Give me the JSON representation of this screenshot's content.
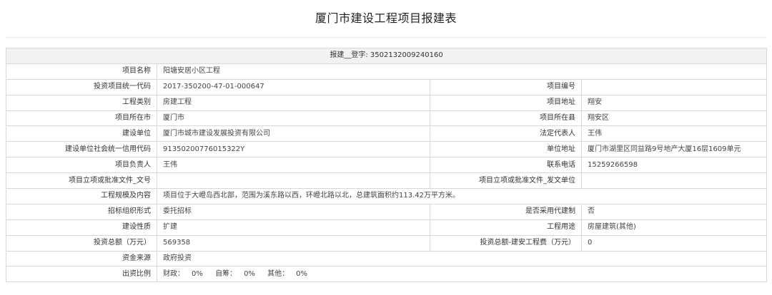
{
  "page_title": "厦门市建设工程项目报建表",
  "header": {
    "prefix": "报建",
    "blank": "__",
    "reg_label": "登字:",
    "reg_number": "3502132009240160"
  },
  "fields": {
    "project_name": {
      "label": "项目名称",
      "value": "阳塘安居小区工程"
    },
    "investment_code": {
      "label": "投资项目统一代码",
      "value": "2017-350200-47-01-000647"
    },
    "project_number": {
      "label": "项目编号",
      "value": ""
    },
    "project_category": {
      "label": "工程类别",
      "value": "房建工程"
    },
    "project_address": {
      "label": "项目地址",
      "value": "翔安"
    },
    "project_city": {
      "label": "项目所在市",
      "value": "厦门市"
    },
    "project_county": {
      "label": "项目所在县",
      "value": "翔安区"
    },
    "builder_unit": {
      "label": "建设单位",
      "value": "厦门市城市建设发展投资有限公司"
    },
    "legal_rep": {
      "label": "法定代表人",
      "value": "王伟"
    },
    "credit_code": {
      "label": "建设单位社会统一信用代码",
      "value": "91350200776015322Y"
    },
    "unit_address": {
      "label": "单位地址",
      "value": "厦门市湖里区同益路9号地产大厦16层1609单元"
    },
    "project_leader": {
      "label": "项目负责人",
      "value": "王伟"
    },
    "contact_phone": {
      "label": "联系电话",
      "value": "15259266598"
    },
    "approval_doc_no": {
      "label": "项目立项或批准文件_文号",
      "value": ""
    },
    "approval_issuer": {
      "label": "项目立项或批准文件_发文单位",
      "value": ""
    },
    "scale_content": {
      "label": "工程规模及内容",
      "value": "项目位于大嶝岛西北部，范围为溪东路以西，环嶝北路以北，总建筑面积约113.42万平方米。"
    },
    "bidding_form": {
      "label": "招标组织形式",
      "value": "委托招标"
    },
    "agent_system": {
      "label": "是否采用代建制",
      "value": "否"
    },
    "build_nature": {
      "label": "建设性质",
      "value": "扩建"
    },
    "project_use": {
      "label": "工程用途",
      "value": "房屋建筑(其他)"
    },
    "total_investment": {
      "label": "投资总额（万元）",
      "value": "569358"
    },
    "install_cost": {
      "label": "投资总额-建安工程费（万元）",
      "value": "0"
    },
    "fund_source": {
      "label": "资金来源",
      "value": "政府投资"
    },
    "invest_ratio": {
      "label": "出资比例",
      "items": [
        {
          "label": "财政：",
          "value": "0%"
        },
        {
          "label": "自筹：",
          "value": "0%"
        },
        {
          "label": "其他：",
          "value": "0%"
        }
      ]
    }
  }
}
